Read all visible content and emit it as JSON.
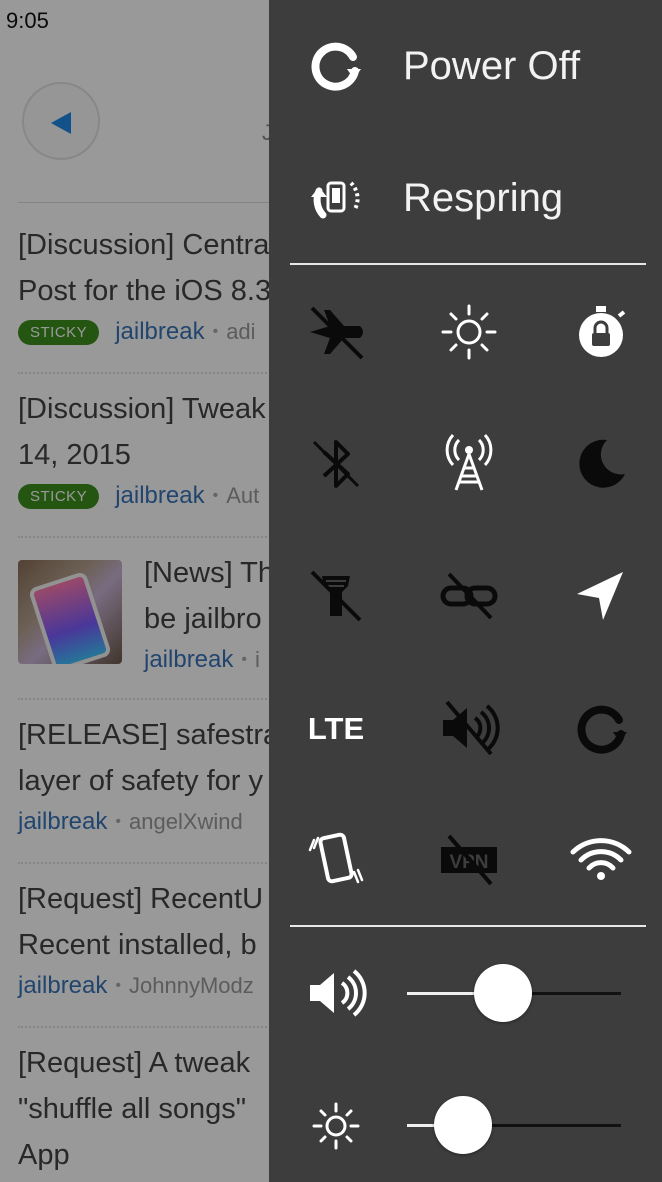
{
  "status": {
    "time": "9:05"
  },
  "background": {
    "header_fragment": "J",
    "posts": [
      {
        "title1": "[Discussion] Centra",
        "title2": "Post for the iOS 8.3",
        "sticky": "STICKY",
        "sub": "jailbreak",
        "author": "adi"
      },
      {
        "title1": "[Discussion] Tweak",
        "title2": "14, 2015",
        "sticky": "STICKY",
        "sub": "jailbreak",
        "author": "Aut"
      },
      {
        "title1": "[News] Th",
        "title2": "be jailbro",
        "sub": "jailbreak",
        "author": "i"
      },
      {
        "title1": "[RELEASE] safestra",
        "title2": "layer of safety for y",
        "sub": "jailbreak",
        "author": "angelXwind"
      },
      {
        "title1": "[Request] RecentU",
        "title2": "Recent installed, b",
        "sub": "jailbreak",
        "author": "JohnnyModz"
      },
      {
        "title1": "[Request] A tweak",
        "title2": "\"shuffle all songs\"",
        "title3": "App"
      }
    ]
  },
  "panel": {
    "power_off": "Power Off",
    "respring": "Respring",
    "toggles": [
      {
        "name": "airplane-mode",
        "icon": "airplane-off-icon",
        "state": "off"
      },
      {
        "name": "auto-brightness",
        "icon": "sun-icon",
        "state": "on"
      },
      {
        "name": "rotation-lock",
        "icon": "lock-timer-icon",
        "state": "on"
      },
      {
        "name": "bluetooth",
        "icon": "bluetooth-off-icon",
        "state": "off"
      },
      {
        "name": "cellular-data",
        "icon": "cell-tower-icon",
        "state": "on"
      },
      {
        "name": "do-not-disturb",
        "icon": "moon-icon",
        "state": "off"
      },
      {
        "name": "flashlight",
        "icon": "flashlight-off-icon",
        "state": "off"
      },
      {
        "name": "hotspot",
        "icon": "link-off-icon",
        "state": "off"
      },
      {
        "name": "location",
        "icon": "location-arrow-icon",
        "state": "on"
      },
      {
        "name": "lte",
        "icon": "lte-icon",
        "label": "LTE",
        "state": "on"
      },
      {
        "name": "ringer",
        "icon": "speaker-mute-icon",
        "state": "off"
      },
      {
        "name": "orientation",
        "icon": "rotate-icon",
        "state": "off"
      },
      {
        "name": "vibration",
        "icon": "vibrate-icon",
        "state": "on"
      },
      {
        "name": "vpn",
        "icon": "vpn-off-icon",
        "label": "VPN",
        "state": "off"
      },
      {
        "name": "wifi",
        "icon": "wifi-icon",
        "state": "on"
      }
    ],
    "sliders": {
      "volume": {
        "icon": "volume-icon",
        "value": 0.45
      },
      "brightness": {
        "icon": "sun-icon",
        "value": 0.26
      }
    },
    "colors": {
      "on": "#ffffff",
      "off": "#0a0a0a",
      "panel": "#3d3d3d"
    }
  }
}
